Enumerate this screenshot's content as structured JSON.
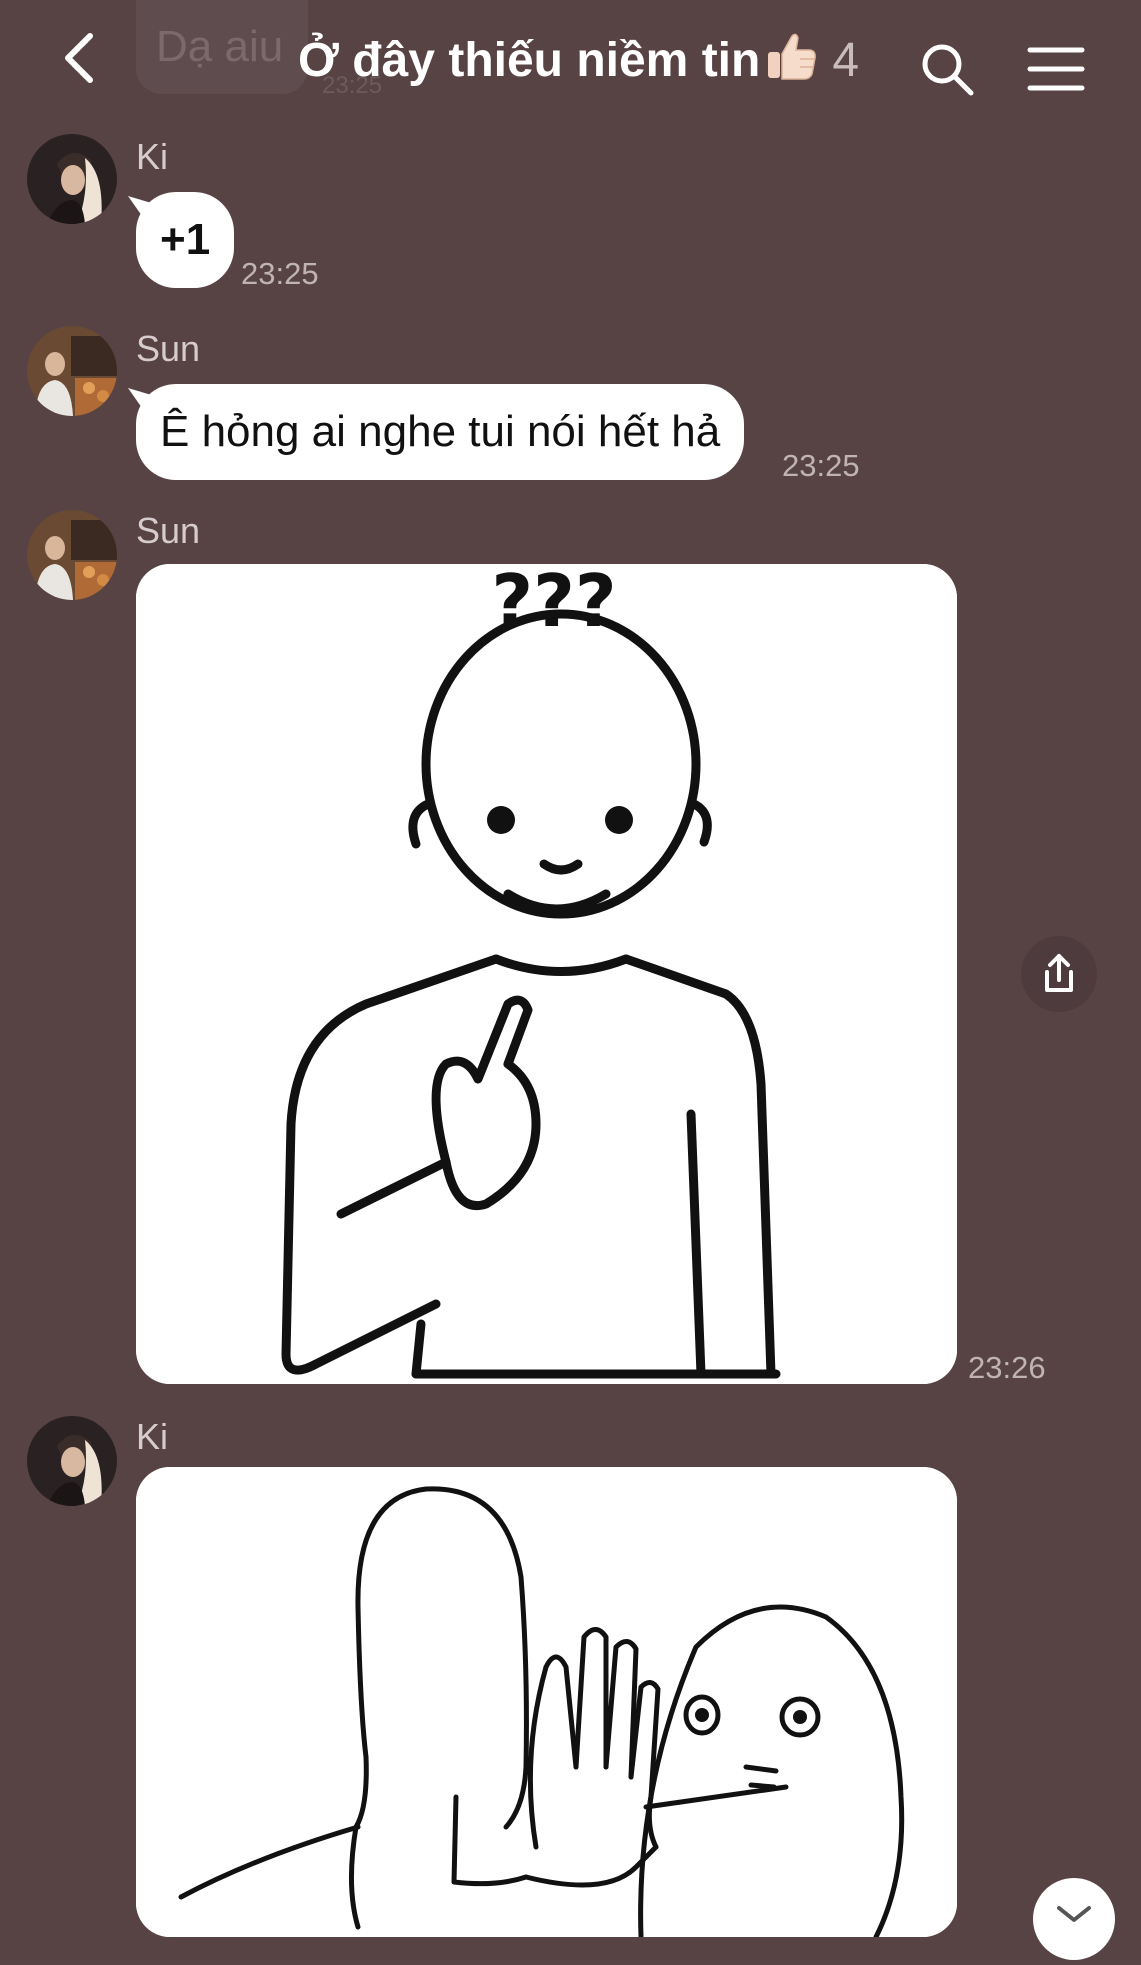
{
  "header": {
    "ghost_preview_text": "Dạ aiu",
    "ghost_preview_time": "23:25",
    "title": "Ở đây thiếu niềm tin",
    "title_emoji": "thumbs-up-icon",
    "member_count": "4",
    "icons": [
      "back-icon",
      "search-icon",
      "menu-icon"
    ]
  },
  "messages": [
    {
      "sender": "Ki",
      "type": "text",
      "text": "+1",
      "time": "23:25"
    },
    {
      "sender": "Sun",
      "type": "text",
      "text": "Ê hỏng ai nghe tui nói hết hả",
      "time": "23:25"
    },
    {
      "sender": "Sun",
      "type": "image",
      "image_text": "???",
      "time": "23:26"
    },
    {
      "sender": "Ki",
      "type": "image"
    }
  ],
  "colors": {
    "background": "#574244",
    "bubble": "#ffffff",
    "secondary_text": "#bfb3b4"
  },
  "controls": {
    "share_icon": "share-upload-icon",
    "scroll_icon": "chevron-down-icon"
  }
}
